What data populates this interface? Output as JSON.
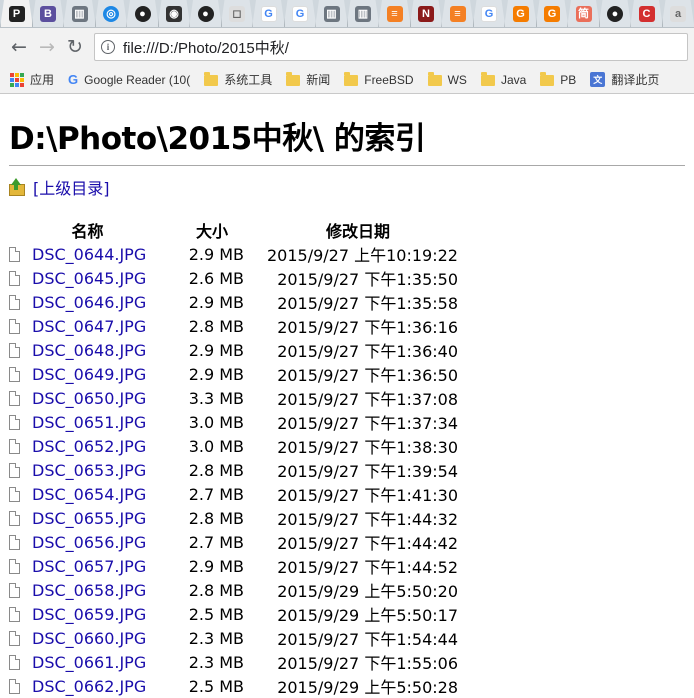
{
  "browser": {
    "tabs": [
      {
        "icon": "p-app-icon",
        "glyph": "P",
        "bg": "#222222"
      },
      {
        "icon": "b-app-icon",
        "glyph": "B",
        "bg": "#5b4f9e"
      },
      {
        "icon": "reader-view-icon",
        "glyph": "▥",
        "bg": "#6d7680"
      },
      {
        "icon": "blue-ring-icon",
        "glyph": "◎",
        "bg": "#1e88e5"
      },
      {
        "icon": "github-icon",
        "glyph": "●",
        "bg": "#222222"
      },
      {
        "icon": "ghost-app-icon",
        "glyph": "◉",
        "bg": "#333333"
      },
      {
        "icon": "github-icon",
        "glyph": "●",
        "bg": "#222222"
      },
      {
        "icon": "blank-page-icon",
        "glyph": "◻",
        "bg": "#dddddd"
      },
      {
        "icon": "google-icon",
        "glyph": "G",
        "bg": "#ffffff"
      },
      {
        "icon": "google-icon",
        "glyph": "G",
        "bg": "#ffffff"
      },
      {
        "icon": "reader-view-icon",
        "glyph": "▥",
        "bg": "#6d7680"
      },
      {
        "icon": "reader-view-icon",
        "glyph": "▥",
        "bg": "#6d7680"
      },
      {
        "icon": "stackoverflow-icon",
        "glyph": "≡",
        "bg": "#f48024"
      },
      {
        "icon": "n-app-icon",
        "glyph": "N",
        "bg": "#8b1a1a"
      },
      {
        "icon": "stackoverflow-icon",
        "glyph": "≡",
        "bg": "#f48024"
      },
      {
        "icon": "google-icon",
        "glyph": "G",
        "bg": "#ffffff"
      },
      {
        "icon": "g-orange-icon",
        "glyph": "G",
        "bg": "#f57c00"
      },
      {
        "icon": "g-orange-icon",
        "glyph": "G",
        "bg": "#f57c00"
      },
      {
        "icon": "jian-app-icon",
        "glyph": "简",
        "bg": "#ea6f5a"
      },
      {
        "icon": "github-icon",
        "glyph": "●",
        "bg": "#222222"
      },
      {
        "icon": "c-red-icon",
        "glyph": "C",
        "bg": "#d32f2f"
      },
      {
        "icon": "a-app-icon",
        "glyph": "a",
        "bg": "#dddddd"
      }
    ],
    "url": "file:///D:/Photo/2015中秋/"
  },
  "bookmarks": [
    {
      "icon": "apps-icon",
      "label": "应用"
    },
    {
      "icon": "google-icon",
      "label": "Google Reader (10("
    },
    {
      "icon": "folder-icon",
      "label": "系统工具"
    },
    {
      "icon": "folder-icon",
      "label": "新闻"
    },
    {
      "icon": "folder-icon",
      "label": "FreeBSD"
    },
    {
      "icon": "folder-icon",
      "label": "WS"
    },
    {
      "icon": "folder-icon",
      "label": "Java"
    },
    {
      "icon": "folder-icon",
      "label": "PB"
    },
    {
      "icon": "translate-icon",
      "label": "翻译此页"
    }
  ],
  "page": {
    "title": "D:\\Photo\\2015中秋\\ 的索引",
    "parent_link": "[上级目录]",
    "headers": {
      "name": "名称",
      "size": "大小",
      "modified": "修改日期"
    },
    "files": [
      {
        "name": "DSC_0644.JPG",
        "size": "2.9 MB",
        "modified": "2015/9/27 上午10:19:22"
      },
      {
        "name": "DSC_0645.JPG",
        "size": "2.6 MB",
        "modified": "2015/9/27 下午1:35:50"
      },
      {
        "name": "DSC_0646.JPG",
        "size": "2.9 MB",
        "modified": "2015/9/27 下午1:35:58"
      },
      {
        "name": "DSC_0647.JPG",
        "size": "2.8 MB",
        "modified": "2015/9/27 下午1:36:16"
      },
      {
        "name": "DSC_0648.JPG",
        "size": "2.9 MB",
        "modified": "2015/9/27 下午1:36:40"
      },
      {
        "name": "DSC_0649.JPG",
        "size": "2.9 MB",
        "modified": "2015/9/27 下午1:36:50"
      },
      {
        "name": "DSC_0650.JPG",
        "size": "3.3 MB",
        "modified": "2015/9/27 下午1:37:08"
      },
      {
        "name": "DSC_0651.JPG",
        "size": "3.0 MB",
        "modified": "2015/9/27 下午1:37:34"
      },
      {
        "name": "DSC_0652.JPG",
        "size": "3.0 MB",
        "modified": "2015/9/27 下午1:38:30"
      },
      {
        "name": "DSC_0653.JPG",
        "size": "2.8 MB",
        "modified": "2015/9/27 下午1:39:54"
      },
      {
        "name": "DSC_0654.JPG",
        "size": "2.7 MB",
        "modified": "2015/9/27 下午1:41:30"
      },
      {
        "name": "DSC_0655.JPG",
        "size": "2.8 MB",
        "modified": "2015/9/27 下午1:44:32"
      },
      {
        "name": "DSC_0656.JPG",
        "size": "2.7 MB",
        "modified": "2015/9/27 下午1:44:42"
      },
      {
        "name": "DSC_0657.JPG",
        "size": "2.9 MB",
        "modified": "2015/9/27 下午1:44:52"
      },
      {
        "name": "DSC_0658.JPG",
        "size": "2.8 MB",
        "modified": "2015/9/29 上午5:50:20"
      },
      {
        "name": "DSC_0659.JPG",
        "size": "2.5 MB",
        "modified": "2015/9/29 上午5:50:17"
      },
      {
        "name": "DSC_0660.JPG",
        "size": "2.3 MB",
        "modified": "2015/9/27 下午1:54:44"
      },
      {
        "name": "DSC_0661.JPG",
        "size": "2.3 MB",
        "modified": "2015/9/27 下午1:55:06"
      },
      {
        "name": "DSC_0662.JPG",
        "size": "2.5 MB",
        "modified": "2015/9/29 上午5:50:28"
      }
    ]
  }
}
